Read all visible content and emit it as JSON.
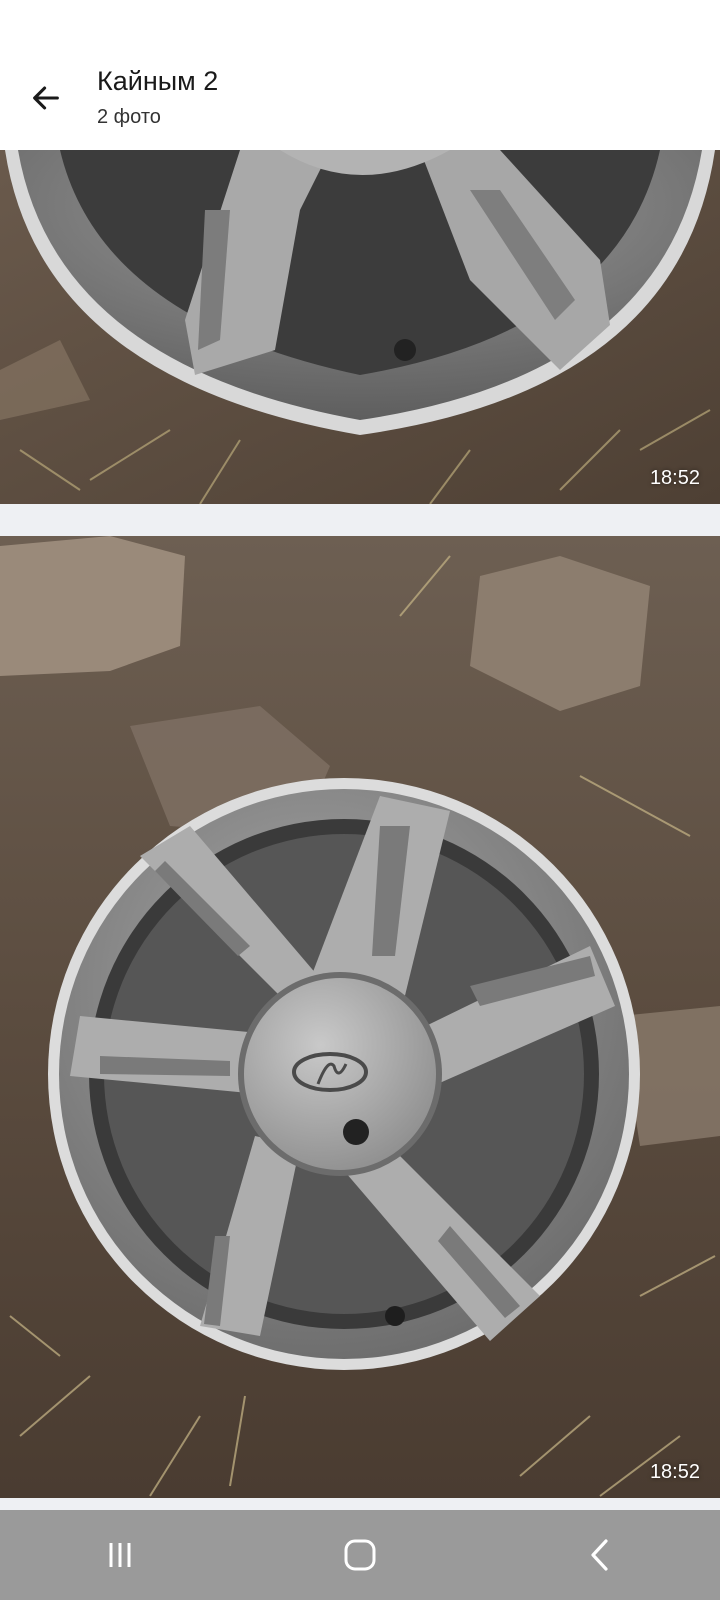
{
  "header": {
    "title": "Кайным 2",
    "subtitle": "2 фото",
    "back_icon": "arrow-left-icon"
  },
  "photos": [
    {
      "timestamp": "18:52",
      "description_icon": "photo-wheel-closeup"
    },
    {
      "timestamp": "18:52",
      "description_icon": "photo-wheel-full"
    }
  ],
  "navbar": {
    "recents_icon": "recents-icon",
    "home_icon": "home-icon",
    "back_icon": "back-chevron-icon"
  },
  "colors": {
    "header_bg": "#ffffff",
    "page_bg": "#eef0f3",
    "navbar_bg": "#9a9a9a"
  }
}
